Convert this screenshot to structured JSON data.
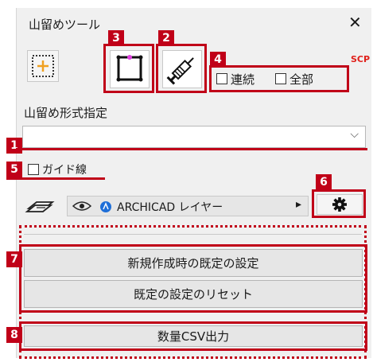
{
  "window": {
    "title": "山留めツール",
    "close_glyph": "✕"
  },
  "toolbar": {
    "scp_label": "SCP",
    "renzoku_label": "連続",
    "zenbu_label": "全部",
    "icons": [
      "add-region-icon",
      "rectangle-select-icon",
      "syringe-icon"
    ]
  },
  "format_section": {
    "label": "山留め形式指定",
    "selected_value": "",
    "chevron": "⌵"
  },
  "guide_line": {
    "label": "ガイド線",
    "checked": false
  },
  "layer": {
    "label": "ARCHICAD レイヤー",
    "arrow": "▸"
  },
  "buttons": {
    "default_new": "新規作成時の既定の設定",
    "reset_default": "既定の設定のリセット",
    "csv_output": "数量CSV出力"
  },
  "annotations": {
    "n1": "1",
    "n2": "2",
    "n3": "3",
    "n4": "4",
    "n5": "5",
    "n6": "6",
    "n7": "7",
    "n8": "8"
  },
  "colors": {
    "annotation_red": "#c00018",
    "marker_magenta": "#e040e0"
  }
}
